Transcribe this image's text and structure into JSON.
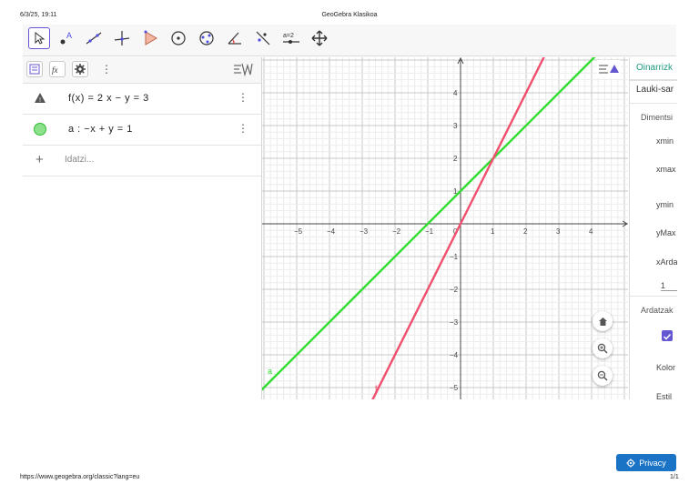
{
  "print": {
    "date": "6/3/25, 19:11",
    "title": "GeoGebra Klasikoa",
    "url": "https://www.geogebra.org/classic?lang=eu",
    "page": "1/1"
  },
  "toolbar": {
    "tools": [
      {
        "name": "move-tool",
        "icon": "arrow-cursor-icon",
        "selected": true
      },
      {
        "name": "point-tool",
        "icon": "point-icon"
      },
      {
        "name": "line-tool",
        "icon": "line-icon"
      },
      {
        "name": "perpendicular-line-tool",
        "icon": "perpendicular-icon"
      },
      {
        "name": "polygon-tool",
        "icon": "polygon-icon"
      },
      {
        "name": "circle-tool",
        "icon": "circle-icon"
      },
      {
        "name": "ellipse-tool",
        "icon": "ellipse-icon"
      },
      {
        "name": "angle-tool",
        "icon": "angle-icon"
      },
      {
        "name": "reflect-tool",
        "icon": "reflect-icon"
      },
      {
        "name": "slider-tool",
        "icon": "slider-icon",
        "text": "a=2"
      },
      {
        "name": "move-view-tool",
        "icon": "move-graphics-icon"
      }
    ]
  },
  "algebra": {
    "rows": [
      {
        "text": "f(x)  =  2 x  −  y  =  3",
        "icon": "warning-icon"
      },
      {
        "text": "a :  −x + y  =  1",
        "icon": "green-dot-icon"
      }
    ],
    "input_placeholder": "Idatzi..."
  },
  "graph": {
    "xmin": -6,
    "xmax": 5,
    "ymin": -5.4,
    "ymax": 5,
    "x_ticks": [
      "−5",
      "−4",
      "−3",
      "−2",
      "−1",
      "0",
      "1",
      "2",
      "3",
      "4"
    ],
    "y_ticks": [
      "4",
      "3",
      "2",
      "1",
      "−1",
      "−2",
      "−3",
      "−4",
      "−5"
    ],
    "line_f_label": "f",
    "line_a_label": "a",
    "colors": {
      "f": "#f0506e",
      "a": "#33dd33"
    }
  },
  "settings": {
    "tab_label": "Oinarrizk",
    "select_value": "Lauki-sar",
    "section_dim": "Dimentsi",
    "xmin": "xmin",
    "xmax": "xmax",
    "ymin": "ymin",
    "ymax": "yMax",
    "ratio": "xArda",
    "ratio_value": "1",
    "section_axes": "Ardatzak",
    "color": "Kolor",
    "style": "Estil"
  },
  "privacy": {
    "label": "Privacy"
  }
}
